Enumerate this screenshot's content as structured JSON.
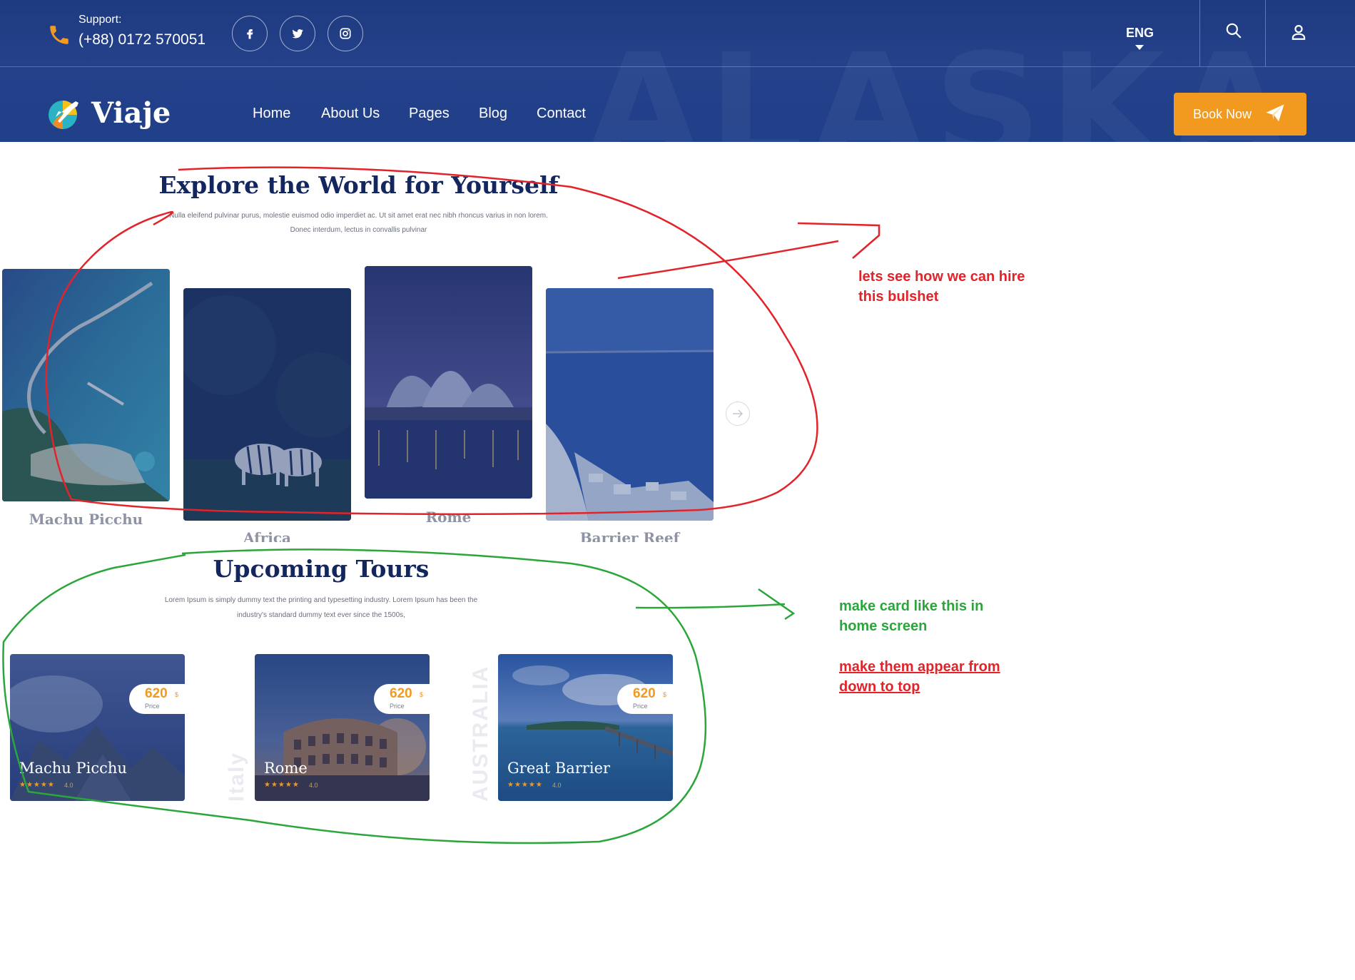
{
  "header": {
    "support_label": "Support:",
    "support_phone": "(+88) 0172 570051",
    "social": [
      "facebook-icon",
      "twitter-icon",
      "instagram-icon"
    ],
    "language": "ENG",
    "logo_text": "Viaje",
    "background_word": "ALASKA",
    "nav": [
      "Home",
      "About Us",
      "Pages",
      "Blog",
      "Contact"
    ],
    "book_button": "Book Now"
  },
  "explore": {
    "title": "Explore the World for Yourself",
    "subtitle_line1": "Nulla eleifend pulvinar purus, molestie euismod odio imperdiet ac. Ut sit amet erat nec nibh rhoncus varius in non lorem.",
    "subtitle_line2": "Donec interdum, lectus in convallis pulvinar",
    "destinations": [
      {
        "name": "Machu Picchu"
      },
      {
        "name": "Africa"
      },
      {
        "name": "Rome"
      },
      {
        "name": "Barrier Reef"
      }
    ]
  },
  "tours": {
    "title": "Upcoming Tours",
    "subtitle_line1": "Lorem Ipsum is simply dummy text the printing and typesetting industry. Lorem Ipsum has been the",
    "subtitle_line2": "industry's standard dummy text ever since the 1500s,",
    "cards": [
      {
        "name": "Machu Picchu",
        "price": "620",
        "currency": "$",
        "price_label": "Price",
        "stars": "★★★★★",
        "rating": "4.0"
      },
      {
        "name": "Rome",
        "price": "620",
        "currency": "$",
        "price_label": "Price",
        "stars": "★★★★★",
        "rating": "4.0"
      },
      {
        "name": "Great Barrier",
        "price": "620",
        "currency": "$",
        "price_label": "Price",
        "stars": "★★★★★",
        "rating": "4.0"
      }
    ],
    "vertical_labels": [
      "Italy",
      "AUSTRALIA"
    ]
  },
  "annotations": {
    "red_note_line1": "lets see how we can hire",
    "red_note_line2": "this bulshet",
    "green_note_line1": "make card like this in",
    "green_note_line2": "home screen",
    "red_underline_line1": "make them appear from",
    "red_underline_line2": "down to top"
  },
  "colors": {
    "header_bg": "#21408a",
    "accent_orange": "#f29a1f",
    "heading_navy": "#13265e",
    "annotation_red": "#e3232a",
    "annotation_green": "#2aa63a"
  }
}
